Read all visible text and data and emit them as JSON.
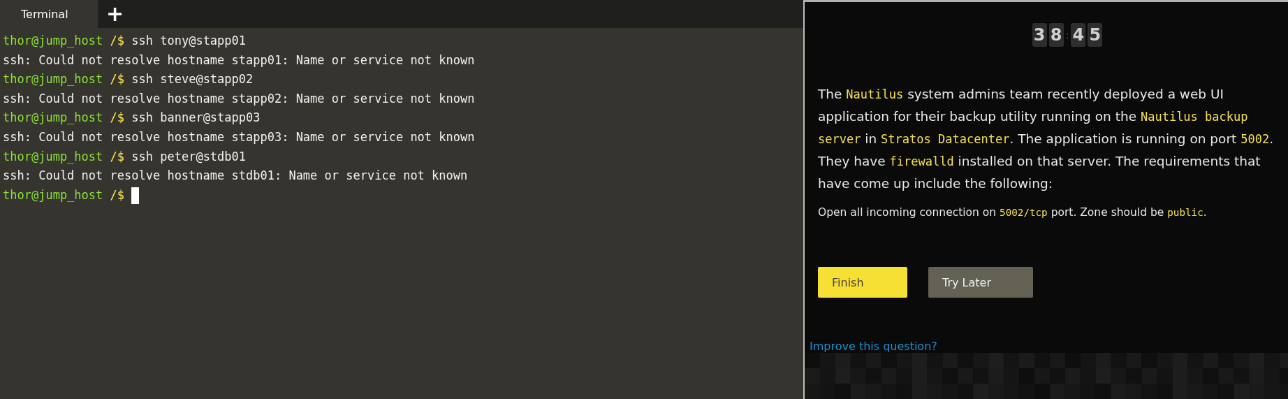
{
  "tabs": [
    {
      "label": "Terminal",
      "selected": true
    }
  ],
  "new_tab": {
    "label": "+"
  },
  "terminal": {
    "lines": [
      {
        "kind": "prompt",
        "user": "thor@jump_host",
        "path": "/$",
        "command": "ssh tony@stapp01"
      },
      {
        "kind": "output",
        "text": "ssh: Could not resolve hostname stapp01: Name or service not known"
      },
      {
        "kind": "prompt",
        "user": "thor@jump_host",
        "path": "/$",
        "command": "ssh steve@stapp02"
      },
      {
        "kind": "output",
        "text": "ssh: Could not resolve hostname stapp02: Name or service not known"
      },
      {
        "kind": "prompt",
        "user": "thor@jump_host",
        "path": "/$",
        "command": "ssh banner@stapp03"
      },
      {
        "kind": "output",
        "text": "ssh: Could not resolve hostname stapp03: Name or service not known"
      },
      {
        "kind": "prompt",
        "user": "thor@jump_host",
        "path": "/$",
        "command": "ssh peter@stdb01"
      },
      {
        "kind": "output",
        "text": "ssh: Could not resolve hostname stdb01: Name or service not known"
      },
      {
        "kind": "prompt_cursor",
        "user": "thor@jump_host",
        "path": "/$"
      }
    ]
  },
  "task": {
    "timer": [
      {
        "kind": "digit",
        "text": "3"
      },
      {
        "kind": "digit",
        "text": "8"
      },
      {
        "kind": "separator",
        "text": ":"
      },
      {
        "kind": "digit",
        "text": "4"
      },
      {
        "kind": "digit",
        "text": "5"
      }
    ],
    "description": [
      {
        "kind": "text",
        "text": "The "
      },
      {
        "kind": "code",
        "text": "Nautilus"
      },
      {
        "kind": "text",
        "text": " system admins team recently deployed a web UI application for their backup utility running on the "
      },
      {
        "kind": "code",
        "text": "Nautilus backup server"
      },
      {
        "kind": "text",
        "text": " in "
      },
      {
        "kind": "code",
        "text": "Stratos Datacenter"
      },
      {
        "kind": "text",
        "text": ". The application is running on port "
      },
      {
        "kind": "code",
        "text": "5002"
      },
      {
        "kind": "text",
        "text": ". They have "
      },
      {
        "kind": "code",
        "text": "firewalld"
      },
      {
        "kind": "text",
        "text": " installed on that server. The requirements that have come up include the following:"
      }
    ],
    "requirement": [
      {
        "kind": "text",
        "text": "Open all incoming connection on "
      },
      {
        "kind": "code",
        "text": "5002/tcp"
      },
      {
        "kind": "text",
        "text": " port. Zone should be "
      },
      {
        "kind": "code",
        "text": "public"
      },
      {
        "kind": "text",
        "text": "."
      }
    ],
    "buttons": [
      {
        "label": "Finish",
        "kind": "primary"
      },
      {
        "label": "Try Later",
        "kind": "secondary"
      }
    ],
    "improve_link": "Improve this question?"
  }
}
